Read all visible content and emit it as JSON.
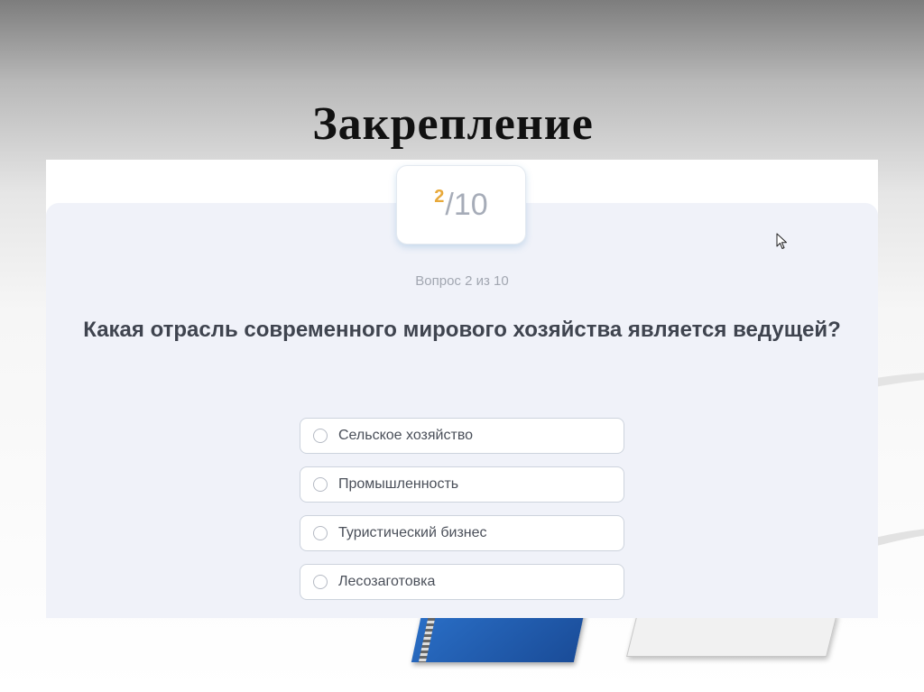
{
  "slide": {
    "title": "Закрепление"
  },
  "quiz": {
    "counter": {
      "current": "2",
      "total": "/10"
    },
    "question_counter": "Вопрос 2 из 10",
    "question": "Какая отрасль современного мирового хозяйства является ведущей?",
    "options": [
      {
        "label": "Сельское хозяйство"
      },
      {
        "label": "Промышленность"
      },
      {
        "label": "Туристический бизнес"
      },
      {
        "label": "Лесозаготовка"
      }
    ]
  },
  "colors": {
    "accent_current": "#e8a93a",
    "panel_background": "#f0f2f9",
    "title_text": "#111111"
  },
  "icons": [
    "radio-icon",
    "mouse-cursor-icon"
  ]
}
